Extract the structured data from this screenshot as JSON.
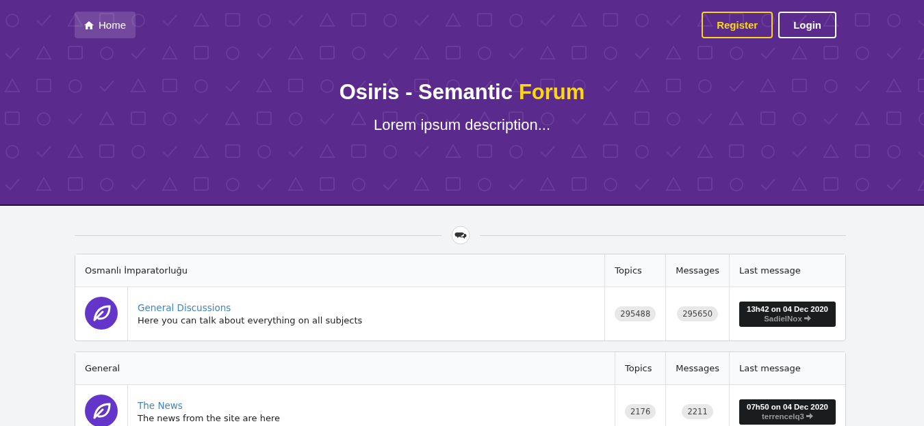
{
  "nav": {
    "home": "Home",
    "register": "Register",
    "login": "Login"
  },
  "header": {
    "title": "Osiris - Semantic",
    "title_accent": "Forum",
    "description": "Lorem ipsum description..."
  },
  "categories": [
    {
      "name": "Osmanlı İmparatorluğu",
      "columns": [
        "Topics",
        "Messages",
        "Last message"
      ],
      "forums": [
        {
          "title": "General Discussions",
          "description": "Here you can talk about everything on all subjects",
          "topics": "295488",
          "messages": "295650",
          "last_time": "13h42 on 04 Dec 2020",
          "last_user": "SadielNox"
        }
      ]
    },
    {
      "name": "General",
      "columns": [
        "Topics",
        "Messages",
        "Last message"
      ],
      "forums": [
        {
          "title": "The News",
          "description": "The news from the site are here",
          "topics": "2176",
          "messages": "2211",
          "last_time": "07h50 on 04 Dec 2020",
          "last_user": "terrencelq3"
        }
      ]
    }
  ]
}
